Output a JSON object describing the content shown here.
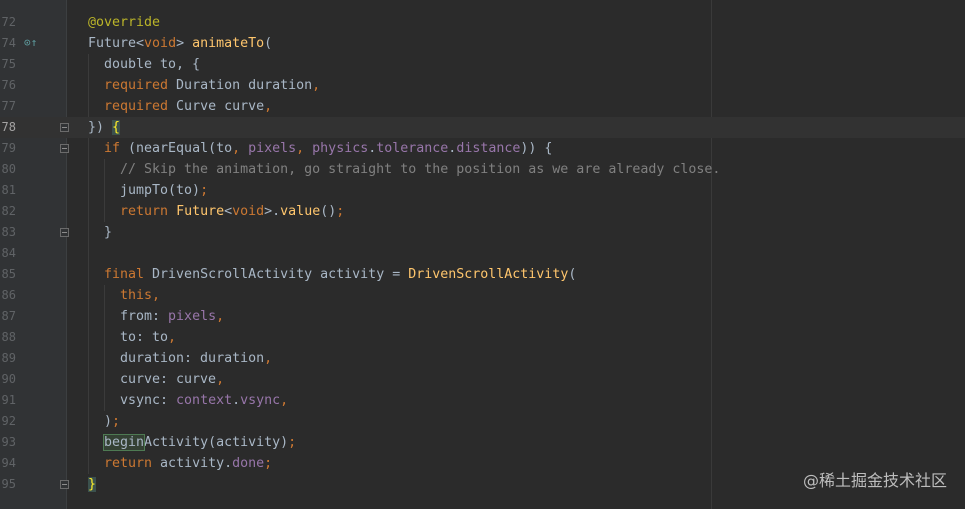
{
  "editor": {
    "lines": [
      {
        "num": "72",
        "current": false,
        "fold": false,
        "icon": false,
        "indent": 0,
        "tokens": [
          {
            "t": "@override",
            "c": "an"
          }
        ]
      },
      {
        "num": "74",
        "current": false,
        "fold": false,
        "icon": true,
        "indent": 0,
        "tokens": [
          {
            "t": "Future<",
            "c": "ty"
          },
          {
            "t": "void",
            "c": "kw"
          },
          {
            "t": "> ",
            "c": "ty"
          },
          {
            "t": "animateTo",
            "c": "fn"
          },
          {
            "t": "(",
            "c": "ty"
          }
        ]
      },
      {
        "num": "75",
        "current": false,
        "fold": false,
        "icon": false,
        "indent": 2,
        "tokens": [
          {
            "t": "double to, {",
            "c": "ty"
          }
        ]
      },
      {
        "num": "76",
        "current": false,
        "fold": false,
        "icon": false,
        "indent": 2,
        "tokens": [
          {
            "t": "required",
            "c": "kw"
          },
          {
            "t": " Duration duration",
            "c": "ty"
          },
          {
            "t": ",",
            "c": "kw"
          }
        ]
      },
      {
        "num": "77",
        "current": false,
        "fold": false,
        "icon": false,
        "indent": 2,
        "tokens": [
          {
            "t": "required",
            "c": "kw"
          },
          {
            "t": " Curve curve",
            "c": "ty"
          },
          {
            "t": ",",
            "c": "kw"
          }
        ]
      },
      {
        "num": "78",
        "current": true,
        "fold": true,
        "icon": false,
        "indent": 0,
        "tokens": [
          {
            "t": "}) ",
            "c": "ty"
          },
          {
            "t": "{",
            "c": "brace-hl"
          }
        ]
      },
      {
        "num": "79",
        "current": false,
        "fold": true,
        "icon": false,
        "indent": 2,
        "tokens": [
          {
            "t": "if",
            "c": "kw"
          },
          {
            "t": " (nearEqual(to",
            "c": "ty"
          },
          {
            "t": ", ",
            "c": "kw"
          },
          {
            "t": "pixels",
            "c": "fld"
          },
          {
            "t": ", ",
            "c": "kw"
          },
          {
            "t": "physics",
            "c": "fld"
          },
          {
            "t": ".",
            "c": "ty"
          },
          {
            "t": "tolerance",
            "c": "fld"
          },
          {
            "t": ".",
            "c": "ty"
          },
          {
            "t": "distance",
            "c": "fld"
          },
          {
            "t": ")) {",
            "c": "ty"
          }
        ]
      },
      {
        "num": "80",
        "current": false,
        "fold": false,
        "icon": false,
        "indent": 4,
        "tokens": [
          {
            "t": "// Skip the animation, go straight to the position as we are already close.",
            "c": "cm"
          }
        ]
      },
      {
        "num": "81",
        "current": false,
        "fold": false,
        "icon": false,
        "indent": 4,
        "tokens": [
          {
            "t": "jumpTo(to)",
            "c": "ty"
          },
          {
            "t": ";",
            "c": "kw"
          }
        ]
      },
      {
        "num": "82",
        "current": false,
        "fold": false,
        "icon": false,
        "indent": 4,
        "tokens": [
          {
            "t": "return",
            "c": "kw"
          },
          {
            "t": " ",
            "c": "ty"
          },
          {
            "t": "Future",
            "c": "fn"
          },
          {
            "t": "<",
            "c": "ty"
          },
          {
            "t": "void",
            "c": "kw"
          },
          {
            "t": ">.",
            "c": "ty"
          },
          {
            "t": "value",
            "c": "fn"
          },
          {
            "t": "()",
            "c": "ty"
          },
          {
            "t": ";",
            "c": "kw"
          }
        ]
      },
      {
        "num": "83",
        "current": false,
        "fold": true,
        "icon": false,
        "indent": 2,
        "tokens": [
          {
            "t": "}",
            "c": "ty"
          }
        ]
      },
      {
        "num": "84",
        "current": false,
        "fold": false,
        "icon": false,
        "indent": 0,
        "tokens": []
      },
      {
        "num": "85",
        "current": false,
        "fold": false,
        "icon": false,
        "indent": 2,
        "tokens": [
          {
            "t": "final",
            "c": "kw"
          },
          {
            "t": " DrivenScrollActivity activity = ",
            "c": "ty"
          },
          {
            "t": "DrivenScrollActivity",
            "c": "fn"
          },
          {
            "t": "(",
            "c": "ty"
          }
        ]
      },
      {
        "num": "86",
        "current": false,
        "fold": false,
        "icon": false,
        "indent": 4,
        "tokens": [
          {
            "t": "this",
            "c": "kw"
          },
          {
            "t": ",",
            "c": "kw"
          }
        ]
      },
      {
        "num": "87",
        "current": false,
        "fold": false,
        "icon": false,
        "indent": 4,
        "tokens": [
          {
            "t": "from: ",
            "c": "ty"
          },
          {
            "t": "pixels",
            "c": "fld"
          },
          {
            "t": ",",
            "c": "kw"
          }
        ]
      },
      {
        "num": "88",
        "current": false,
        "fold": false,
        "icon": false,
        "indent": 4,
        "tokens": [
          {
            "t": "to: to",
            "c": "ty"
          },
          {
            "t": ",",
            "c": "kw"
          }
        ]
      },
      {
        "num": "89",
        "current": false,
        "fold": false,
        "icon": false,
        "indent": 4,
        "tokens": [
          {
            "t": "duration: duration",
            "c": "ty"
          },
          {
            "t": ",",
            "c": "kw"
          }
        ]
      },
      {
        "num": "90",
        "current": false,
        "fold": false,
        "icon": false,
        "indent": 4,
        "tokens": [
          {
            "t": "curve: curve",
            "c": "ty"
          },
          {
            "t": ",",
            "c": "kw"
          }
        ]
      },
      {
        "num": "91",
        "current": false,
        "fold": false,
        "icon": false,
        "indent": 4,
        "tokens": [
          {
            "t": "vsync: ",
            "c": "ty"
          },
          {
            "t": "context",
            "c": "fld"
          },
          {
            "t": ".",
            "c": "ty"
          },
          {
            "t": "vsync",
            "c": "fld"
          },
          {
            "t": ",",
            "c": "kw"
          }
        ]
      },
      {
        "num": "92",
        "current": false,
        "fold": false,
        "icon": false,
        "indent": 2,
        "tokens": [
          {
            "t": ")",
            "c": "ty"
          },
          {
            "t": ";",
            "c": "kw"
          }
        ]
      },
      {
        "num": "93",
        "current": false,
        "fold": false,
        "icon": false,
        "indent": 2,
        "tokens": [
          {
            "t": "begin",
            "c": "id-hl"
          },
          {
            "t": "Activity(activity)",
            "c": "ty"
          },
          {
            "t": ";",
            "c": "kw"
          }
        ]
      },
      {
        "num": "94",
        "current": false,
        "fold": false,
        "icon": false,
        "indent": 2,
        "tokens": [
          {
            "t": "return",
            "c": "kw"
          },
          {
            "t": " activity.",
            "c": "ty"
          },
          {
            "t": "done",
            "c": "fld"
          },
          {
            "t": ";",
            "c": "kw"
          }
        ]
      },
      {
        "num": "95",
        "current": false,
        "fold": true,
        "icon": false,
        "indent": 0,
        "tokens": [
          {
            "t": "}",
            "c": "brace-hl"
          }
        ]
      }
    ]
  },
  "watermark": {
    "text": "@稀土掘金技术社区"
  }
}
